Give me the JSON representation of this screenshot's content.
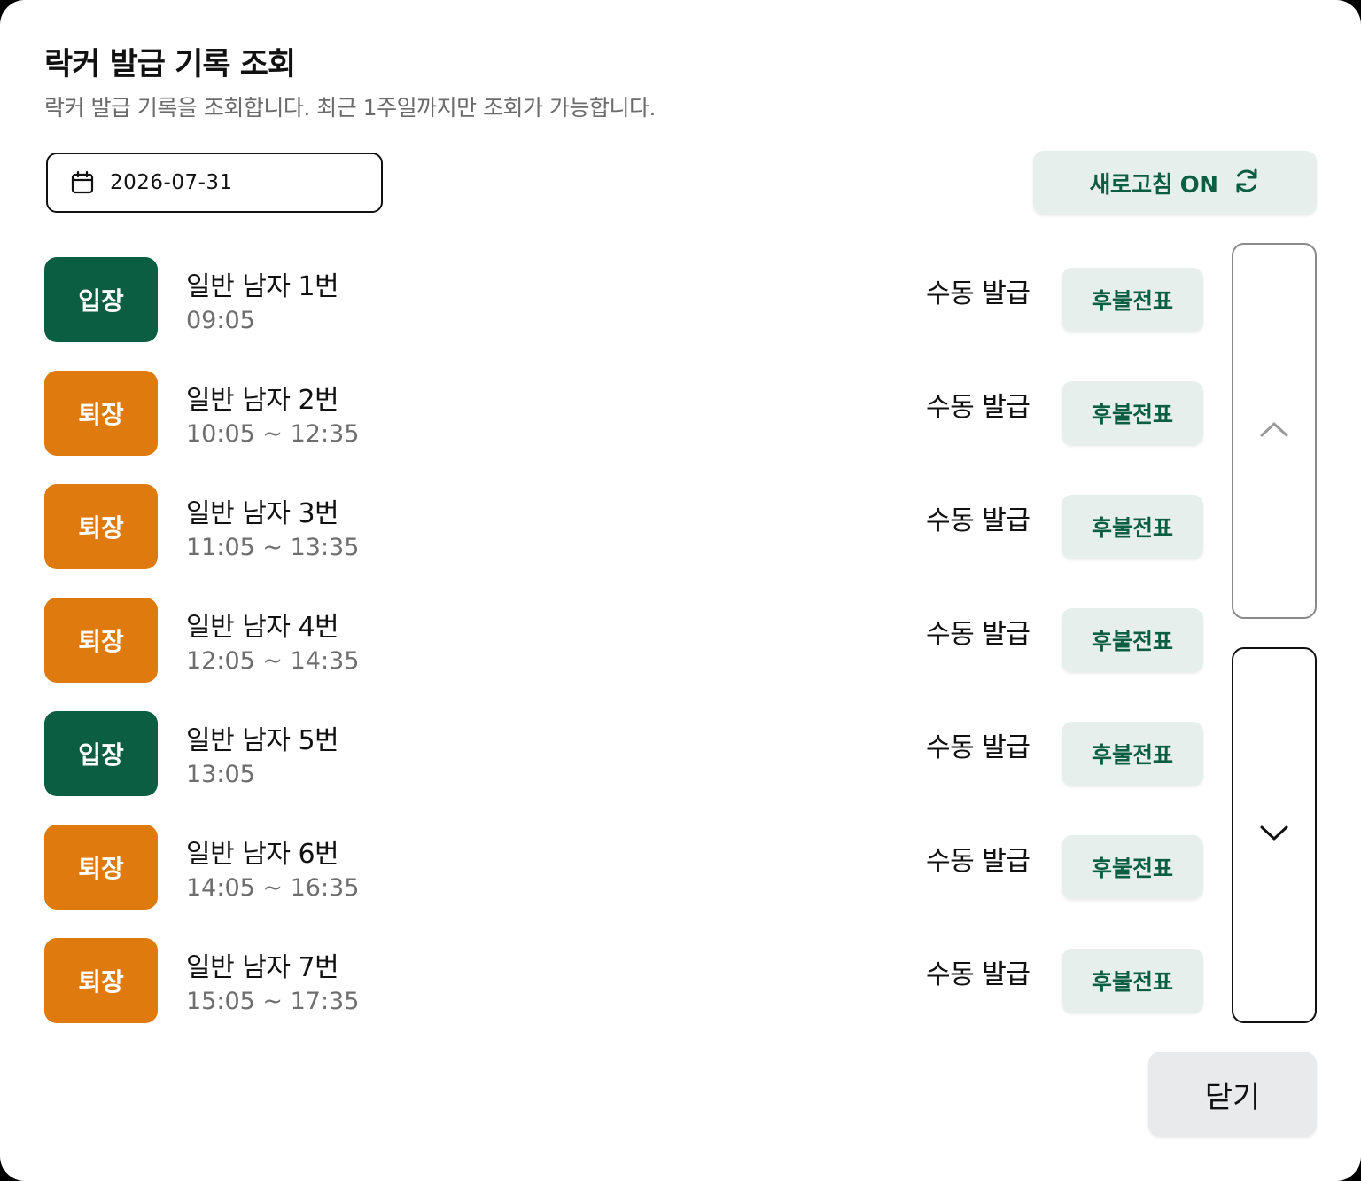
{
  "dialog": {
    "title": "락커 발급 기록 조회",
    "subtitle": "락커 발급 기록을 조회합니다. 최근 1주일까지만 조회가 가능합니다."
  },
  "date_filter": {
    "value": "2026-07-31",
    "icon": "calendar-icon"
  },
  "refresh": {
    "label": "새로고침 ON",
    "icon": "refresh-icon"
  },
  "records": [
    {
      "status": "입장",
      "type": "enter",
      "name": "일반 남자 1번",
      "time": "09:05",
      "issue": "수동 발급",
      "ticket": "후불전표"
    },
    {
      "status": "퇴장",
      "type": "exit",
      "name": "일반 남자 2번",
      "time": "10:05 ~ 12:35",
      "issue": "수동 발급",
      "ticket": "후불전표"
    },
    {
      "status": "퇴장",
      "type": "exit",
      "name": "일반 남자 3번",
      "time": "11:05 ~ 13:35",
      "issue": "수동 발급",
      "ticket": "후불전표"
    },
    {
      "status": "퇴장",
      "type": "exit",
      "name": "일반 남자 4번",
      "time": "12:05 ~ 14:35",
      "issue": "수동 발급",
      "ticket": "후불전표"
    },
    {
      "status": "입장",
      "type": "enter",
      "name": "일반 남자 5번",
      "time": "13:05",
      "issue": "수동 발급",
      "ticket": "후불전표"
    },
    {
      "status": "퇴장",
      "type": "exit",
      "name": "일반 남자 6번",
      "time": "14:05 ~ 16:35",
      "issue": "수동 발급",
      "ticket": "후불전표"
    },
    {
      "status": "퇴장",
      "type": "exit",
      "name": "일반 남자 7번",
      "time": "15:05 ~ 17:35",
      "issue": "수동 발급",
      "ticket": "후불전표"
    }
  ],
  "scroll": {
    "up_icon": "chevron-up-icon",
    "down_icon": "chevron-down-icon"
  },
  "close": {
    "label": "닫기"
  },
  "colors": {
    "brand_green": "#0c5e43",
    "exit_orange": "#df7a0e",
    "soft_green": "#e6efeb"
  }
}
